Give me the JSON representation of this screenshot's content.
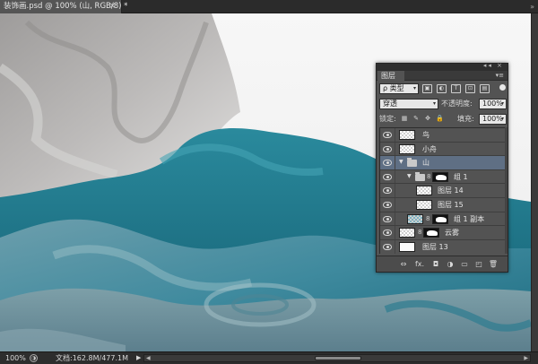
{
  "document": {
    "tab_title": "装饰画.psd @ 100% (山, RGB/8) *",
    "close_glyph": "×",
    "tabs_arrow": "»"
  },
  "layers_panel": {
    "tab_label": "图层",
    "collapse_glyph": "◂◂",
    "close_glyph": "×",
    "menu_glyph": "▾≡",
    "filter_kind": "ρ 类型",
    "filter_icons": [
      "▣",
      "◐",
      "T",
      "⊡",
      "▤"
    ],
    "blend_mode": "穿透",
    "opacity_label": "不透明度:",
    "opacity_value": "100%",
    "lock_label": "锁定:",
    "lock_icons": [
      "▦",
      "✎",
      "✥",
      "🔒"
    ],
    "fill_label": "填充:",
    "fill_value": "100%",
    "layers": [
      {
        "name": "鸟",
        "type": "pixel",
        "visible": true
      },
      {
        "name": "小舟",
        "type": "pixel",
        "visible": true
      },
      {
        "name": "山",
        "type": "group",
        "expanded": true,
        "selected": true,
        "visible": true
      },
      {
        "name": "组 1",
        "type": "group",
        "expanded": true,
        "has_mask": true,
        "visible": true
      },
      {
        "name": "图层 14",
        "type": "pixel",
        "visible": true
      },
      {
        "name": "图层 15",
        "type": "pixel",
        "visible": true
      },
      {
        "name": "组 1 副本",
        "type": "group",
        "has_mask": true,
        "visible": true
      },
      {
        "name": "云雾",
        "type": "pixel",
        "has_mask": true,
        "visible": true
      },
      {
        "name": "图层 13",
        "type": "pixel",
        "white_fill": true,
        "visible": true
      }
    ],
    "bottom_buttons": [
      "⇔",
      "fx.",
      "◘",
      "◑",
      "▭",
      "◰",
      "🗑"
    ]
  },
  "statusbar": {
    "zoom": "100%",
    "doc_info": "文档:162.8M/477.1M",
    "arrow": "▶",
    "scroll_left": "◀",
    "scroll_right": "▶"
  },
  "colors": {
    "ui_dark": "#323232",
    "panel": "#535353",
    "selected_row": "#5f6f84",
    "teal": "#1f7a8c",
    "teal_dark": "#0f5566"
  }
}
